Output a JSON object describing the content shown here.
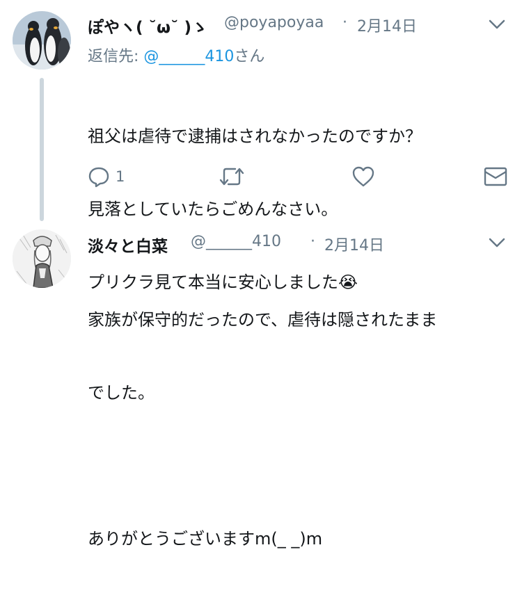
{
  "tweet1": {
    "name": "ぽやヽ( ˘ω˘ )ゝ",
    "handle": "@poyapoyaa",
    "separator": "·",
    "date": "2月14日",
    "reply_prefix": "返信先:",
    "reply_handle": "@______410",
    "reply_suffix": "さん",
    "lines": [
      "祖父は虐待で逮捕はされなかったのですか？",
      "見落としていたらごめんなさい。",
      "プリクラ見て本当に安心しました"
    ],
    "emoji": "😭",
    "reply_count": "1"
  },
  "tweet2": {
    "name": "淡々と白菜",
    "handle": "@______410",
    "separator": "·",
    "date": "2月14日",
    "lines": [
      "家族が保守的だったので、虐待は隠されたまま",
      "でした。",
      "",
      "ありがとうございますm(_ _)m"
    ]
  },
  "colors": {
    "text": "#14171a",
    "muted": "#657786",
    "link": "#1b95e0",
    "thread_line": "#ccd6dd"
  }
}
